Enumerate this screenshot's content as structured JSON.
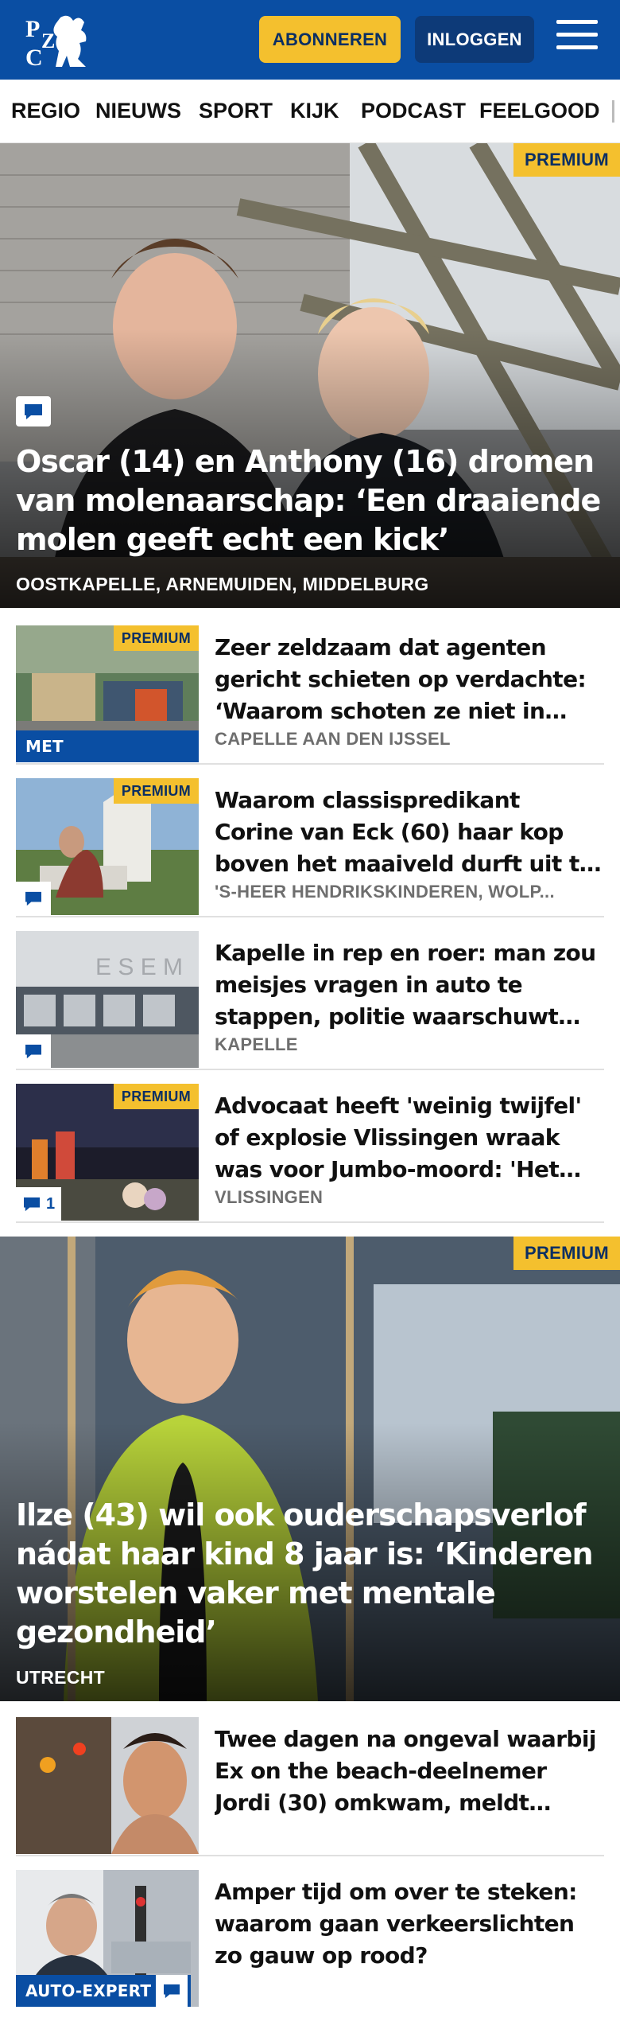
{
  "header": {
    "subscribe_label": "ABONNEREN",
    "login_label": "INLOGGEN",
    "brand_color": "#0a4ea3",
    "accent_color": "#f4c02e"
  },
  "nav": {
    "items": [
      "REGIO",
      "NIEUWS",
      "SPORT",
      "KIJK",
      "PODCAST",
      "FEELGOOD"
    ]
  },
  "badges": {
    "premium": "PREMIUM"
  },
  "hero1": {
    "title": "Oscar (14) en Anthony (16) dromen van molenaarschap: ‘Een draaiende molen geeft echt een kick’",
    "location": "OOSTKAPELLE, ARNEMUIDEN, MIDDELBURG"
  },
  "articles": [
    {
      "title": "Zeer zeldzaam dat agenten gericht schieten op verdachte: ‘Waarom schoten ze niet in bee...",
      "location": "CAPELLE AAN DEN IJSSEL",
      "video_label": "MET UITLEGVIDEO"
    },
    {
      "title": "Waarom classispredikant Corine van Eck (60) haar kop boven het maaiveld durft uit te steken: ‘Di...",
      "location": "'S-HEER HENDRIKSKINDEREN, WOLP..."
    },
    {
      "title": "Kapelle in rep en roer: man zou meisjes vragen in auto te stappen, politie waarschuwt vo...",
      "location": "KAPELLE"
    },
    {
      "title": "Advocaat heeft 'weinig twijfel' of explosie Vlissingen wraak was voor Jumbo-moord: 'Het gezin...",
      "location": "VLISSINGEN",
      "comment_count": "1"
    }
  ],
  "hero2": {
    "title": "Ilze (43) wil ook ouderschapsverlof nádat haar kind 8 jaar is: ‘Kinderen worstelen vaker met mentale gezondheid’",
    "location": "UTRECHT"
  },
  "articles2": [
    {
      "title": "Twee dagen na ongeval waarbij Ex on the beach-deelnemer Jordi (30) omkwam, meldt bestuurde..."
    },
    {
      "title": "Amper tijd om over te steken: waarom gaan verkeerslichten zo gauw op rood?",
      "label": "AUTO-EXPERT"
    }
  ]
}
